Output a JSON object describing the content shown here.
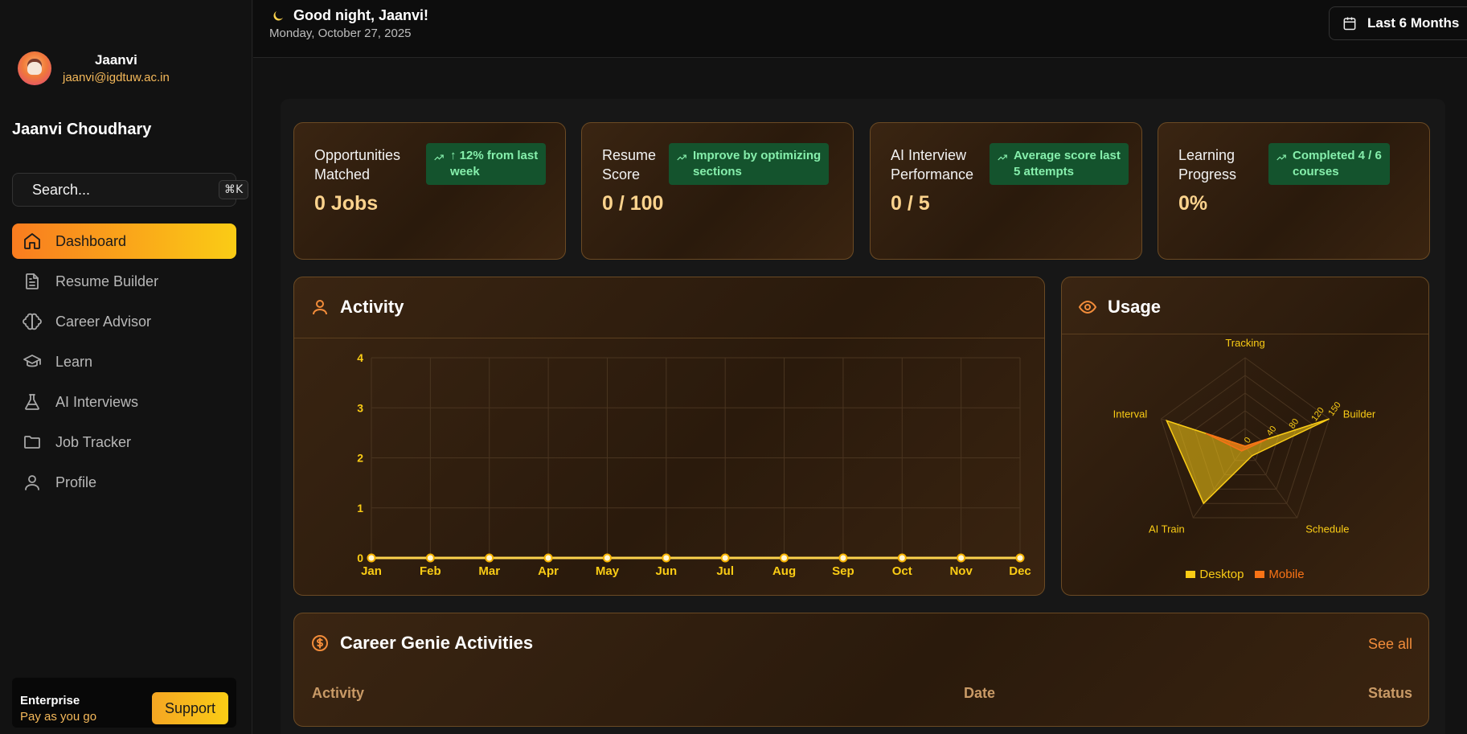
{
  "sidebar": {
    "user_name": "Jaanvi",
    "user_email": "jaanvi@igdtuw.ac.in",
    "full_name": "Jaanvi Choudhary",
    "search_placeholder": "Search...",
    "search_shortcut": "⌘K",
    "items": [
      {
        "label": "Dashboard",
        "icon": "home-icon",
        "active": true
      },
      {
        "label": "Resume Builder",
        "icon": "file-text-icon",
        "active": false
      },
      {
        "label": "Career Advisor",
        "icon": "brain-icon",
        "active": false
      },
      {
        "label": "Learn",
        "icon": "graduation-cap-icon",
        "active": false
      },
      {
        "label": "AI Interviews",
        "icon": "flask-icon",
        "active": false
      },
      {
        "label": "Job Tracker",
        "icon": "folder-icon",
        "active": false
      },
      {
        "label": "Profile",
        "icon": "user-icon",
        "active": false
      }
    ],
    "plan_title": "Enterprise",
    "plan_subtitle": "Pay as you go",
    "support_label": "Support"
  },
  "header": {
    "greeting": "Good night, Jaanvi!",
    "date": "Monday, October 27, 2025",
    "range_label": "Last 6 Months"
  },
  "stats": [
    {
      "label_line1": "Opportunities",
      "label_line2": "Matched",
      "badge_line1": "↑ 12% from last",
      "badge_line2": "week",
      "value": "0 Jobs"
    },
    {
      "label_line1": "Resume",
      "label_line2": "Score",
      "badge_line1": "Improve by optimizing",
      "badge_line2": "sections",
      "value": "0 / 100"
    },
    {
      "label_line1": "AI Interview",
      "label_line2": "Performance",
      "badge_line1": "Average score last",
      "badge_line2": "5 attempts",
      "value": "0 / 5"
    },
    {
      "label_line1": "Learning",
      "label_line2": "Progress",
      "badge_line1": "Completed 4 / 6",
      "badge_line2": "courses",
      "value": "0%"
    }
  ],
  "activity": {
    "title": "Activity"
  },
  "usage": {
    "title": "Usage"
  },
  "career": {
    "title": "Career Genie Activities",
    "see_all": "See all",
    "columns": [
      "Activity",
      "Date",
      "Status"
    ]
  },
  "colors": {
    "accent": "#f28c3a",
    "line": "#fcd34d",
    "desktop": "#facc15",
    "mobile": "#f97316",
    "badge_bg": "#14532d",
    "badge_text": "#86efac"
  },
  "chart_data": [
    {
      "type": "line",
      "categories": [
        "Jan",
        "Feb",
        "Mar",
        "Apr",
        "May",
        "Jun",
        "Jul",
        "Aug",
        "Sep",
        "Oct",
        "Nov",
        "Dec"
      ],
      "values": [
        0,
        0,
        0,
        0,
        0,
        0,
        0,
        0,
        0,
        0,
        0,
        0
      ],
      "ylim": [
        0,
        4
      ],
      "yticks": [
        "0",
        "1",
        "2",
        "3",
        "4"
      ],
      "grid": true
    },
    {
      "type": "radar",
      "categories": [
        "Tracking",
        "Builder",
        "Schedule",
        "AI Train",
        "Interval"
      ],
      "radial_ticks": [
        "0",
        "40",
        "80",
        "120",
        "150"
      ],
      "rmax": 150,
      "series": [
        {
          "name": "Desktop",
          "values": [
            0,
            150,
            20,
            120,
            140
          ]
        },
        {
          "name": "Mobile",
          "values": [
            0,
            40,
            5,
            10,
            70
          ]
        }
      ],
      "legend": "bottom"
    }
  ]
}
